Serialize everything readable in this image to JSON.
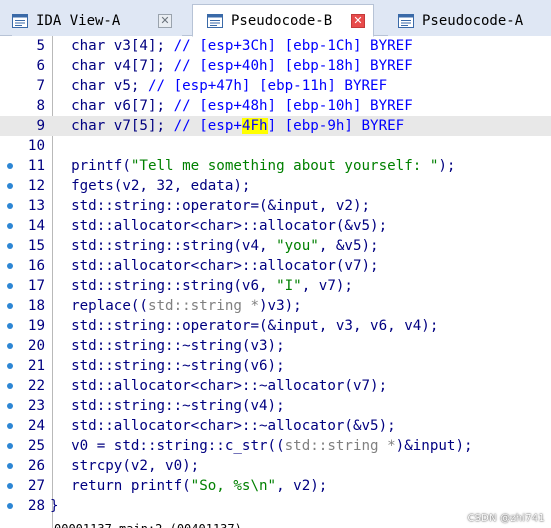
{
  "tabs": [
    {
      "label": "IDA View-A",
      "icon": "graph-view-icon",
      "active": false,
      "close": "grey"
    },
    {
      "label": "Pseudocode-B",
      "icon": "pseudocode-icon",
      "active": true,
      "close": "red"
    },
    {
      "label": "Pseudocode-A",
      "icon": "pseudocode-icon",
      "active": false
    }
  ],
  "colors": {
    "keyword": "#000080",
    "comment": "#0000ff",
    "string": "#008000",
    "highlight": "#ffff00",
    "breakpoint_dot": "#2d86d4",
    "current_line": "#e8e8e8"
  },
  "code_lines": [
    {
      "num": "5",
      "dot": false,
      "tokens": [
        [
          "kw",
          "  char v3[4]; "
        ],
        [
          "cmt",
          "// [esp+3Ch] [ebp-1Ch] BYREF"
        ]
      ]
    },
    {
      "num": "6",
      "dot": false,
      "tokens": [
        [
          "kw",
          "  char v4[7]; "
        ],
        [
          "cmt",
          "// [esp+40h] [ebp-18h] BYREF"
        ]
      ]
    },
    {
      "num": "7",
      "dot": false,
      "tokens": [
        [
          "kw",
          "  char v5; "
        ],
        [
          "cmt",
          "// [esp+47h] [ebp-11h] BYREF"
        ]
      ]
    },
    {
      "num": "8",
      "dot": false,
      "tokens": [
        [
          "kw",
          "  char v6[7]; "
        ],
        [
          "cmt",
          "// [esp+48h] [ebp-10h] BYREF"
        ]
      ]
    },
    {
      "num": "9",
      "dot": false,
      "current": true,
      "tokens": [
        [
          "kw",
          "  char v7[5]; "
        ],
        [
          "cmt",
          "// [esp+"
        ],
        [
          "hl",
          "4Fh"
        ],
        [
          "cmt",
          "] [ebp-9h] BYREF"
        ]
      ]
    },
    {
      "num": "10",
      "dot": false,
      "tokens": []
    },
    {
      "num": "11",
      "dot": true,
      "tokens": [
        [
          "kw",
          "  printf("
        ],
        [
          "str",
          "\"Tell me something about yourself: \""
        ],
        [
          "kw",
          ");"
        ]
      ]
    },
    {
      "num": "12",
      "dot": true,
      "tokens": [
        [
          "kw",
          "  fgets(v2, 32, edata);"
        ]
      ]
    },
    {
      "num": "13",
      "dot": true,
      "tokens": [
        [
          "kw",
          "  std::string::operator=(&input, v2);"
        ]
      ]
    },
    {
      "num": "14",
      "dot": true,
      "tokens": [
        [
          "kw",
          "  std::allocator<char>::allocator(&v5);"
        ]
      ]
    },
    {
      "num": "15",
      "dot": true,
      "tokens": [
        [
          "kw",
          "  std::string::string(v4, "
        ],
        [
          "str",
          "\"you\""
        ],
        [
          "kw",
          ", &v5);"
        ]
      ]
    },
    {
      "num": "16",
      "dot": true,
      "tokens": [
        [
          "kw",
          "  std::allocator<char>::allocator(v7);"
        ]
      ]
    },
    {
      "num": "17",
      "dot": true,
      "tokens": [
        [
          "kw",
          "  std::string::string(v6, "
        ],
        [
          "str",
          "\"I\""
        ],
        [
          "kw",
          ", v7);"
        ]
      ]
    },
    {
      "num": "18",
      "dot": true,
      "tokens": [
        [
          "kw",
          "  replace(("
        ],
        [
          "grey",
          "std::string *"
        ],
        [
          "kw",
          ")v3);"
        ]
      ]
    },
    {
      "num": "19",
      "dot": true,
      "tokens": [
        [
          "kw",
          "  std::string::operator=(&input, v3, v6, v4);"
        ]
      ]
    },
    {
      "num": "20",
      "dot": true,
      "tokens": [
        [
          "kw",
          "  std::string::~string(v3);"
        ]
      ]
    },
    {
      "num": "21",
      "dot": true,
      "tokens": [
        [
          "kw",
          "  std::string::~string(v6);"
        ]
      ]
    },
    {
      "num": "22",
      "dot": true,
      "tokens": [
        [
          "kw",
          "  std::allocator<char>::~allocator(v7);"
        ]
      ]
    },
    {
      "num": "23",
      "dot": true,
      "tokens": [
        [
          "kw",
          "  std::string::~string(v4);"
        ]
      ]
    },
    {
      "num": "24",
      "dot": true,
      "tokens": [
        [
          "kw",
          "  std::allocator<char>::~allocator(&v5);"
        ]
      ]
    },
    {
      "num": "25",
      "dot": true,
      "tokens": [
        [
          "kw",
          "  v0 = std::string::c_str(("
        ],
        [
          "grey",
          "std::string *"
        ],
        [
          "kw",
          ")&input);"
        ]
      ]
    },
    {
      "num": "26",
      "dot": true,
      "tokens": [
        [
          "kw",
          "  strcpy(v2, v0);"
        ]
      ]
    },
    {
      "num": "27",
      "dot": true,
      "tokens": [
        [
          "kw",
          "  return printf("
        ],
        [
          "str",
          "\"So, %s\\n\""
        ],
        [
          "kw",
          ", v2);"
        ]
      ]
    },
    {
      "num": "28",
      "dot": true,
      "tokens": [
        [
          "kw",
          "}"
        ]
      ]
    }
  ],
  "status_cutoff": "00001137 main:2 (00401137)",
  "watermark": "CSDN @zhi741"
}
